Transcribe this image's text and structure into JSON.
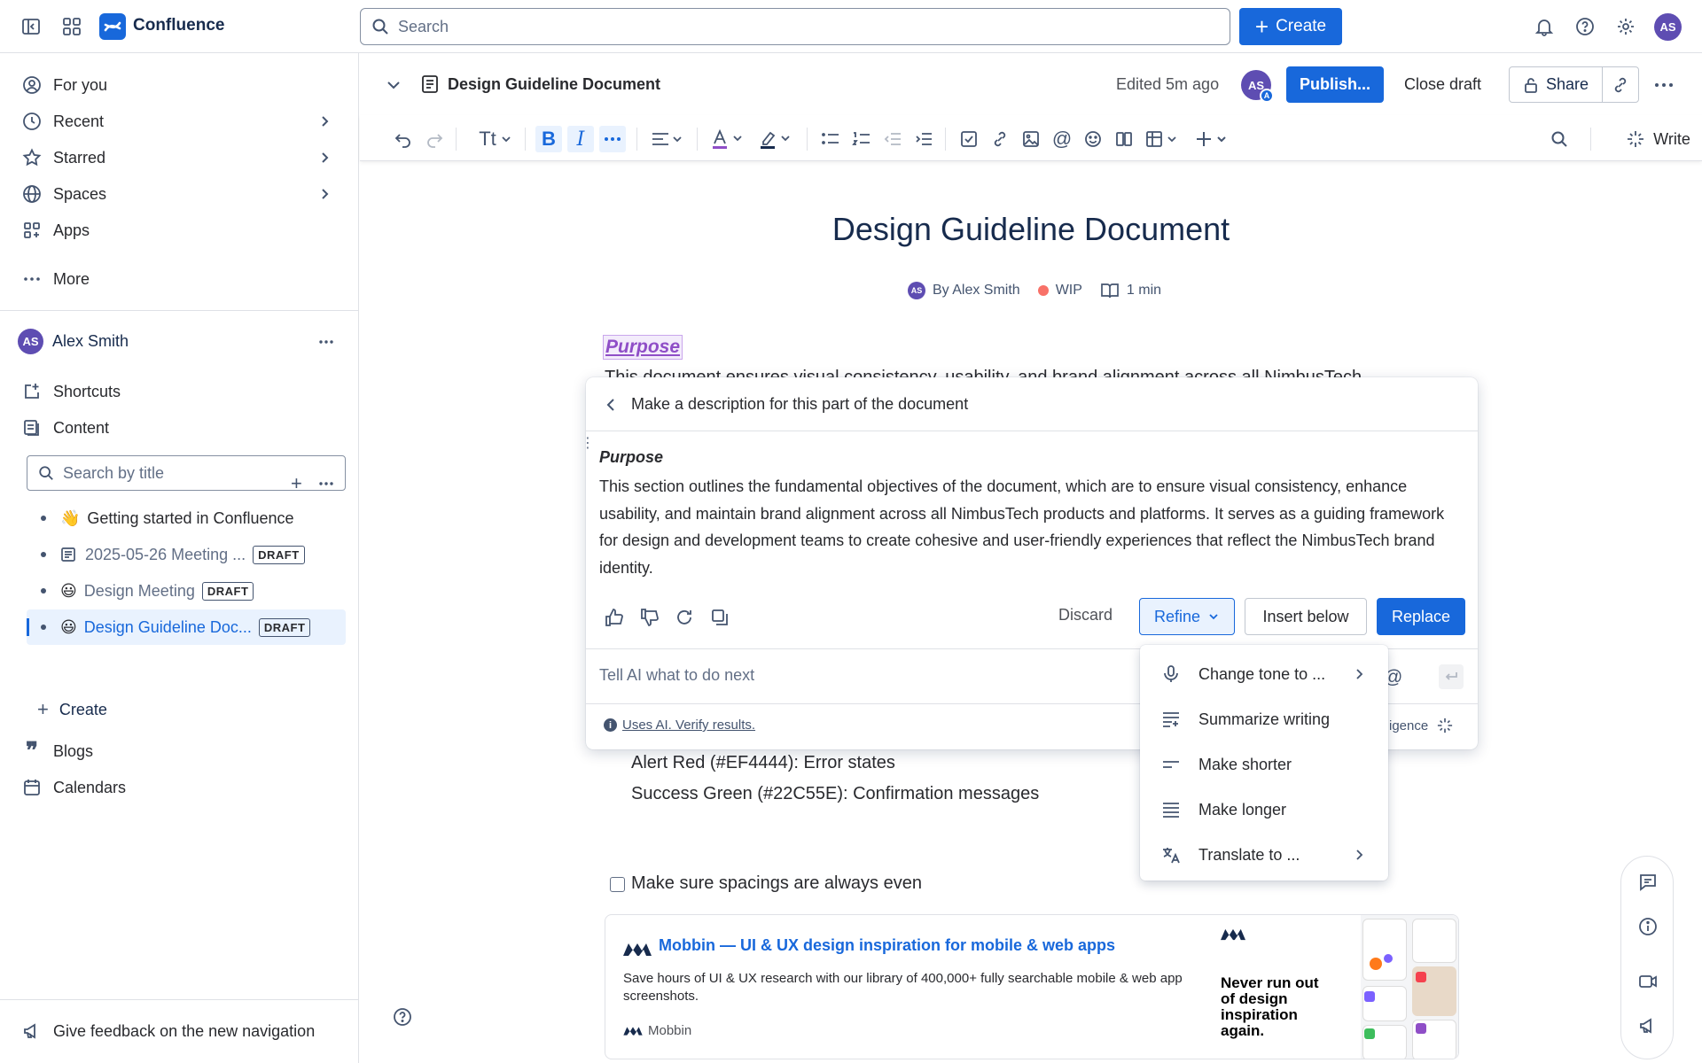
{
  "topbar": {
    "app_name": "Confluence",
    "search_placeholder": "Search",
    "create_label": "Create",
    "avatar_initials": "AS"
  },
  "sidebar": {
    "nav": [
      {
        "label": "For you"
      },
      {
        "label": "Recent"
      },
      {
        "label": "Starred"
      },
      {
        "label": "Spaces"
      },
      {
        "label": "Apps"
      },
      {
        "label": "More"
      }
    ],
    "user_name": "Alex Smith",
    "user_initials": "AS",
    "shortcuts_label": "Shortcuts",
    "content_label": "Content",
    "search_placeholder": "Search by title",
    "tree": [
      {
        "emoji": "👋",
        "label": "Getting started in Confluence",
        "draft": ""
      },
      {
        "emoji": "",
        "label": "2025-05-26 Meeting ...",
        "draft": "DRAFT"
      },
      {
        "emoji": "😃",
        "label": "Design Meeting",
        "draft": "DRAFT"
      },
      {
        "emoji": "😃",
        "label": "Design Guideline Doc...",
        "draft": "DRAFT"
      }
    ],
    "create_label": "Create",
    "blogs_label": "Blogs",
    "calendars_label": "Calendars",
    "feedback_label": "Give feedback on the new navigation"
  },
  "header": {
    "doc_name": "Design Guideline Document",
    "edited": "Edited 5m ago",
    "avatar_initials": "AS",
    "avatar_badge": "A",
    "publish_label": "Publish...",
    "close_draft_label": "Close draft",
    "share_label": "Share"
  },
  "toolbar": {
    "text_style": "Tt",
    "write_label": "Write"
  },
  "document": {
    "title": "Design Guideline Document",
    "byline_initials": "AS",
    "author": "By Alex Smith",
    "status": "WIP",
    "read_time": "1 min",
    "purpose_heading": "Purpose",
    "partial_line": "This document ensures visual consistency, usability, and brand alignment across all NimbusTech",
    "color_lines": [
      "Alert Red (#EF4444): Error states",
      "Success Green (#22C55E): Confirmation messages"
    ],
    "checkbox_label": "Make sure spacings are always even"
  },
  "ai_panel": {
    "prompt_title": "Make a description for this part of the document",
    "result_heading": "Purpose",
    "result_text": "This section outlines the fundamental objectives of the document, which are to ensure visual consistency, enhance usability, and maintain brand alignment across all NimbusTech products and platforms. It serves as a guiding framework for design and development teams to create cohesive and user-friendly experiences that reflect the NimbusTech brand identity.",
    "discard_label": "Discard",
    "refine_label": "Refine",
    "insert_below_label": "Insert below",
    "replace_label": "Replace",
    "input_placeholder": "Tell AI what to do next",
    "disclaimer": "Uses AI. Verify results.",
    "footer_right": "igence"
  },
  "refine_menu": {
    "items": [
      {
        "label": "Change tone to ...",
        "icon": "microphone-icon",
        "submenu": true
      },
      {
        "label": "Summarize writing",
        "icon": "summarize-icon",
        "submenu": false
      },
      {
        "label": "Make shorter",
        "icon": "shorter-icon",
        "submenu": false
      },
      {
        "label": "Make longer",
        "icon": "longer-icon",
        "submenu": false
      },
      {
        "label": "Translate to ...",
        "icon": "translate-icon",
        "submenu": true
      }
    ]
  },
  "link_card": {
    "title": "Mobbin — UI & UX design inspiration for mobile & web apps",
    "description": "Save hours of UI & UX research with our library of 400,000+ fully searchable mobile & web app screenshots.",
    "source": "Mobbin",
    "promo_text": "Never run out of design inspiration again."
  },
  "colors": {
    "brand_blue": "#1868db",
    "avatar_purple": "#5e4db2",
    "purpose_purple": "#8f4ec7",
    "status_red": "#f87168"
  }
}
